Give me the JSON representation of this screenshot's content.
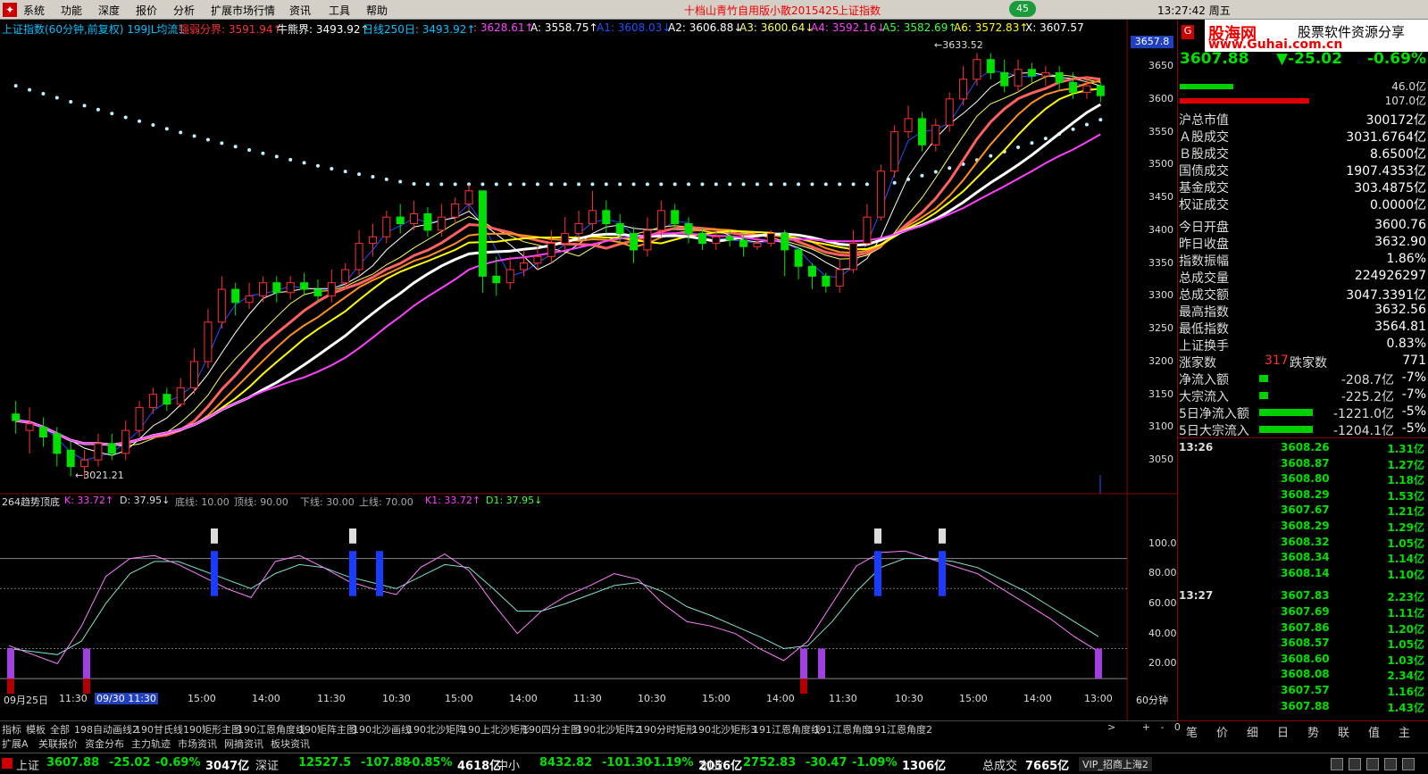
{
  "menubar": {
    "items": [
      "系统",
      "功能",
      "深度",
      "报价",
      "分析",
      "扩展市场行情",
      "资讯",
      "工具",
      "帮助"
    ],
    "title": "十档山青竹自用版小散2015425",
    "title2": "上证指数",
    "badge": "45",
    "time": "13:27:42",
    "weekday": "周五"
  },
  "legend": [
    {
      "text": "上证指数(60分钟,前复权) 199JL均流1",
      "color": "#00c0ff"
    },
    {
      "text": "强弱分界: 3591.94↑",
      "color": "#ff3030"
    },
    {
      "text": "牛熊界: 3493.92↑",
      "color": "#ffffff"
    },
    {
      "text": "日线250日: 3493.92↑",
      "color": "#00c0ff"
    },
    {
      "text": ": 3628.61↑",
      "color": "#ff40ff"
    },
    {
      "text": "A: 3558.75↑",
      "color": "#ffffff"
    },
    {
      "text": "A1: 3608.03↓",
      "color": "#2050ff"
    },
    {
      "text": "A2: 3606.88↓",
      "color": "#ffffff"
    },
    {
      "text": "A3: 3600.64↓",
      "color": "#ffff60"
    },
    {
      "text": "A4: 3592.16↓",
      "color": "#ff40ff"
    },
    {
      "text": "A5: 3582.69↑",
      "color": "#40ff40"
    },
    {
      "text": "A6: 3572.83↑",
      "color": "#ffff00"
    },
    {
      "text": "X: 3607.57",
      "color": "#ffffff"
    }
  ],
  "chart_annotations": {
    "high": "3633.52",
    "low": "3021.21",
    "last_box": "3657.8"
  },
  "price_axis": [
    "3650",
    "3600",
    "3550",
    "3500",
    "3450",
    "3400",
    "3350",
    "3300",
    "3250",
    "3200",
    "3150",
    "3100",
    "3050"
  ],
  "sub_legend": [
    {
      "text": "264趋势顶底",
      "color": "#ddd"
    },
    {
      "text": "K: 33.72↑",
      "color": "#ff40ff"
    },
    {
      "text": "D: 37.95↓",
      "color": "#ddd"
    },
    {
      "text": "底线: 10.00",
      "color": "#aaa"
    },
    {
      "text": "顶线: 90.00",
      "color": "#aaa"
    },
    {
      "text": "下线: 30.00",
      "color": "#aaa"
    },
    {
      "text": "上线: 70.00",
      "color": "#aaa"
    },
    {
      "text": "K1: 33.72↑",
      "color": "#ff40ff"
    },
    {
      "text": "D1: 37.95↓",
      "color": "#40ff40"
    }
  ],
  "sub_axis": [
    "100.0",
    "80.00",
    "60.00",
    "40.00",
    "20.00"
  ],
  "x_axis": [
    "09月25日",
    "11:30",
    "09/30 11:30",
    "15:00",
    "14:00",
    "11:30",
    "10:30",
    "15:00",
    "14:00",
    "11:30",
    "10:30",
    "15:00",
    "14:00",
    "11:30",
    "10:30",
    "15:00",
    "14:00",
    "13:00",
    "60分钟"
  ],
  "tabs1": [
    "指标",
    "模板",
    "全部",
    "198自动画线2",
    "190甘氏线",
    "190矩形主图",
    "190江恩角度线",
    "190矩阵主图",
    "190北沙画线",
    "190北沙矩阵",
    "190上北沙矩形",
    "190四分主图",
    "190北沙矩阵2",
    "190分时矩形",
    "190北沙矩形3",
    "191江恩角度线",
    "191江恩角度",
    "191江恩角度2"
  ],
  "tabs2": [
    "扩展A",
    "关联报价",
    "资金分布",
    "主力轨迹",
    "市场资讯",
    "网摘资讯",
    "板块资讯"
  ],
  "right_panel": {
    "logo": "股海网",
    "logo2": "股票软件资源分享",
    "url": "www.Guhai.com.cn",
    "price": "3607.88",
    "change": "-25.02",
    "pct": "-0.69%",
    "bar1_val": "46.0亿",
    "bar2_val": "107.0亿",
    "rows": [
      {
        "k": "沪总市值",
        "v": "300172亿"
      },
      {
        "k": "Ａ股成交",
        "v": "3031.6764亿"
      },
      {
        "k": "Ｂ股成交",
        "v": "8.6500亿"
      },
      {
        "k": "国债成交",
        "v": "1907.4353亿"
      },
      {
        "k": "基金成交",
        "v": "303.4875亿"
      },
      {
        "k": "权证成交",
        "v": "0.0000亿"
      },
      {
        "k": "今日开盘",
        "v": "3600.76"
      },
      {
        "k": "昨日收盘",
        "v": "3632.90"
      },
      {
        "k": "指数振幅",
        "v": "1.86%"
      },
      {
        "k": "总成交量",
        "v": "224926297"
      },
      {
        "k": "总成交额",
        "v": "3047.3391亿"
      },
      {
        "k": "最高指数",
        "v": "3632.56"
      },
      {
        "k": "最低指数",
        "v": "3564.81"
      },
      {
        "k": "上证换手",
        "v": "0.83%"
      }
    ],
    "updown": {
      "up_label": "涨家数",
      "up": "317",
      "down_label": "跌家数",
      "down": "771"
    },
    "flows": [
      {
        "k": "净流入额",
        "v": "-208.7亿",
        "p": "-7%"
      },
      {
        "k": "大宗流入",
        "v": "-225.2亿",
        "p": "-7%"
      },
      {
        "k": "5日净流入额",
        "v": "-1221.0亿",
        "p": "-5%"
      },
      {
        "k": "5日大宗流入",
        "v": "-1204.1亿",
        "p": "-5%"
      }
    ],
    "ticks": [
      {
        "t": "13:26",
        "p": "3608.26",
        "a": "1.31亿"
      },
      {
        "t": "",
        "p": "3608.87",
        "a": "1.27亿"
      },
      {
        "t": "",
        "p": "3608.80",
        "a": "1.18亿"
      },
      {
        "t": "",
        "p": "3608.29",
        "a": "1.53亿"
      },
      {
        "t": "",
        "p": "3607.67",
        "a": "1.21亿"
      },
      {
        "t": "",
        "p": "3608.29",
        "a": "1.29亿"
      },
      {
        "t": "",
        "p": "3608.32",
        "a": "1.05亿"
      },
      {
        "t": "",
        "p": "3608.34",
        "a": "1.14亿"
      },
      {
        "t": "",
        "p": "3608.14",
        "a": "1.10亿"
      },
      {
        "t": "13:27",
        "p": "3607.83",
        "a": "2.23亿"
      },
      {
        "t": "",
        "p": "3607.69",
        "a": "1.11亿"
      },
      {
        "t": "",
        "p": "3607.86",
        "a": "1.20亿"
      },
      {
        "t": "",
        "p": "3608.57",
        "a": "1.05亿"
      },
      {
        "t": "",
        "p": "3608.60",
        "a": "1.03亿"
      },
      {
        "t": "",
        "p": "3608.08",
        "a": "2.34亿"
      },
      {
        "t": "",
        "p": "3607.57",
        "a": "1.16亿"
      },
      {
        "t": "",
        "p": "3607.88",
        "a": "1.43亿"
      }
    ],
    "bottom_tabs": [
      "笔",
      "价",
      "细",
      "日",
      "势",
      "联",
      "值",
      "主"
    ]
  },
  "status": [
    {
      "name": "上证",
      "price": "3607.88",
      "chg": "-25.02",
      "pct": "-0.69%",
      "vol": "3047亿"
    },
    {
      "name": "深证",
      "price": "12527.5",
      "chg": "-107.88",
      "pct": "-0.85%",
      "vol": "4618亿"
    },
    {
      "name": "中小",
      "price": "8432.82",
      "chg": "-101.30",
      "pct": "-1.19%",
      "vol": "2056亿"
    },
    {
      "name": "创业",
      "price": "2752.83",
      "chg": "-30.47",
      "pct": "-1.09%",
      "vol": "1306亿"
    }
  ],
  "status_total": {
    "label": "总成交",
    "value": "7665亿"
  },
  "status_vip": "VIP_招商上海2",
  "chart_data": {
    "type": "candlestick",
    "ylim": [
      3000,
      3680
    ],
    "sub_ylim": [
      0,
      110
    ],
    "candles": [
      [
        3120,
        3110,
        3140,
        3090
      ],
      [
        3095,
        3105,
        3130,
        3060
      ],
      [
        3100,
        3085,
        3115,
        3070
      ],
      [
        3090,
        3060,
        3100,
        3040
      ],
      [
        3065,
        3040,
        3080,
        3025
      ],
      [
        3040,
        3050,
        3065,
        3021
      ],
      [
        3050,
        3075,
        3090,
        3040
      ],
      [
        3075,
        3060,
        3090,
        3050
      ],
      [
        3060,
        3095,
        3110,
        3050
      ],
      [
        3095,
        3130,
        3140,
        3085
      ],
      [
        3130,
        3150,
        3160,
        3120
      ],
      [
        3150,
        3135,
        3160,
        3125
      ],
      [
        3135,
        3160,
        3175,
        3130
      ],
      [
        3160,
        3200,
        3220,
        3150
      ],
      [
        3200,
        3260,
        3280,
        3190
      ],
      [
        3260,
        3310,
        3330,
        3250
      ],
      [
        3310,
        3290,
        3320,
        3270
      ],
      [
        3290,
        3300,
        3320,
        3280
      ],
      [
        3300,
        3320,
        3330,
        3290
      ],
      [
        3320,
        3305,
        3330,
        3290
      ],
      [
        3305,
        3320,
        3330,
        3295
      ],
      [
        3320,
        3310,
        3335,
        3300
      ],
      [
        3310,
        3300,
        3325,
        3290
      ],
      [
        3300,
        3320,
        3340,
        3290
      ],
      [
        3320,
        3340,
        3350,
        3310
      ],
      [
        3340,
        3380,
        3400,
        3330
      ],
      [
        3380,
        3390,
        3410,
        3360
      ],
      [
        3390,
        3420,
        3430,
        3380
      ],
      [
        3420,
        3410,
        3440,
        3395
      ],
      [
        3410,
        3425,
        3445,
        3400
      ],
      [
        3425,
        3400,
        3435,
        3390
      ],
      [
        3400,
        3420,
        3440,
        3390
      ],
      [
        3420,
        3440,
        3450,
        3410
      ],
      [
        3440,
        3460,
        3470,
        3430
      ],
      [
        3460,
        3330,
        3460,
        3305
      ],
      [
        3330,
        3320,
        3360,
        3300
      ],
      [
        3320,
        3340,
        3360,
        3310
      ],
      [
        3340,
        3350,
        3370,
        3330
      ],
      [
        3350,
        3360,
        3375,
        3340
      ],
      [
        3360,
        3380,
        3400,
        3350
      ],
      [
        3380,
        3395,
        3420,
        3370
      ],
      [
        3395,
        3410,
        3430,
        3385
      ],
      [
        3410,
        3430,
        3460,
        3400
      ],
      [
        3430,
        3410,
        3445,
        3395
      ],
      [
        3410,
        3395,
        3425,
        3380
      ],
      [
        3395,
        3370,
        3405,
        3350
      ],
      [
        3370,
        3400,
        3420,
        3360
      ],
      [
        3400,
        3430,
        3445,
        3390
      ],
      [
        3430,
        3410,
        3440,
        3400
      ],
      [
        3410,
        3395,
        3420,
        3380
      ],
      [
        3395,
        3380,
        3405,
        3370
      ],
      [
        3380,
        3390,
        3400,
        3370
      ],
      [
        3390,
        3385,
        3400,
        3375
      ],
      [
        3385,
        3375,
        3395,
        3360
      ],
      [
        3375,
        3380,
        3390,
        3370
      ],
      [
        3380,
        3395,
        3400,
        3375
      ],
      [
        3395,
        3370,
        3400,
        3330
      ],
      [
        3370,
        3345,
        3375,
        3325
      ],
      [
        3345,
        3330,
        3350,
        3310
      ],
      [
        3330,
        3315,
        3335,
        3305
      ],
      [
        3315,
        3340,
        3355,
        3305
      ],
      [
        3340,
        3380,
        3400,
        3335
      ],
      [
        3380,
        3420,
        3440,
        3375
      ],
      [
        3420,
        3490,
        3500,
        3415
      ],
      [
        3490,
        3550,
        3560,
        3480
      ],
      [
        3550,
        3570,
        3590,
        3540
      ],
      [
        3570,
        3530,
        3580,
        3520
      ],
      [
        3530,
        3560,
        3570,
        3520
      ],
      [
        3560,
        3600,
        3610,
        3550
      ],
      [
        3600,
        3630,
        3650,
        3590
      ],
      [
        3630,
        3660,
        3670,
        3620
      ],
      [
        3660,
        3640,
        3670,
        3630
      ],
      [
        3640,
        3620,
        3660,
        3610
      ],
      [
        3620,
        3645,
        3660,
        3610
      ],
      [
        3645,
        3635,
        3655,
        3625
      ],
      [
        3635,
        3640,
        3650,
        3620
      ],
      [
        3640,
        3625,
        3650,
        3615
      ],
      [
        3625,
        3610,
        3640,
        3600
      ],
      [
        3610,
        3620,
        3635,
        3600
      ],
      [
        3620,
        3605,
        3625,
        3595
      ]
    ],
    "sub_k": [
      32,
      26,
      20,
      45,
      78,
      90,
      92,
      86,
      78,
      70,
      64,
      88,
      92,
      84,
      75,
      70,
      66,
      84,
      93,
      82,
      60,
      40,
      55,
      65,
      72,
      80,
      76,
      60,
      48,
      45,
      40,
      30,
      22,
      35,
      60,
      85,
      94,
      95,
      90,
      85,
      80,
      70,
      60,
      50,
      38,
      28
    ],
    "sub_d": [
      30,
      28,
      26,
      35,
      60,
      80,
      88,
      88,
      82,
      76,
      70,
      80,
      86,
      84,
      78,
      74,
      70,
      78,
      86,
      84,
      70,
      55,
      55,
      60,
      66,
      72,
      74,
      68,
      58,
      52,
      45,
      38,
      30,
      32,
      48,
      68,
      84,
      90,
      90,
      88,
      84,
      76,
      68,
      58,
      48,
      38
    ]
  }
}
